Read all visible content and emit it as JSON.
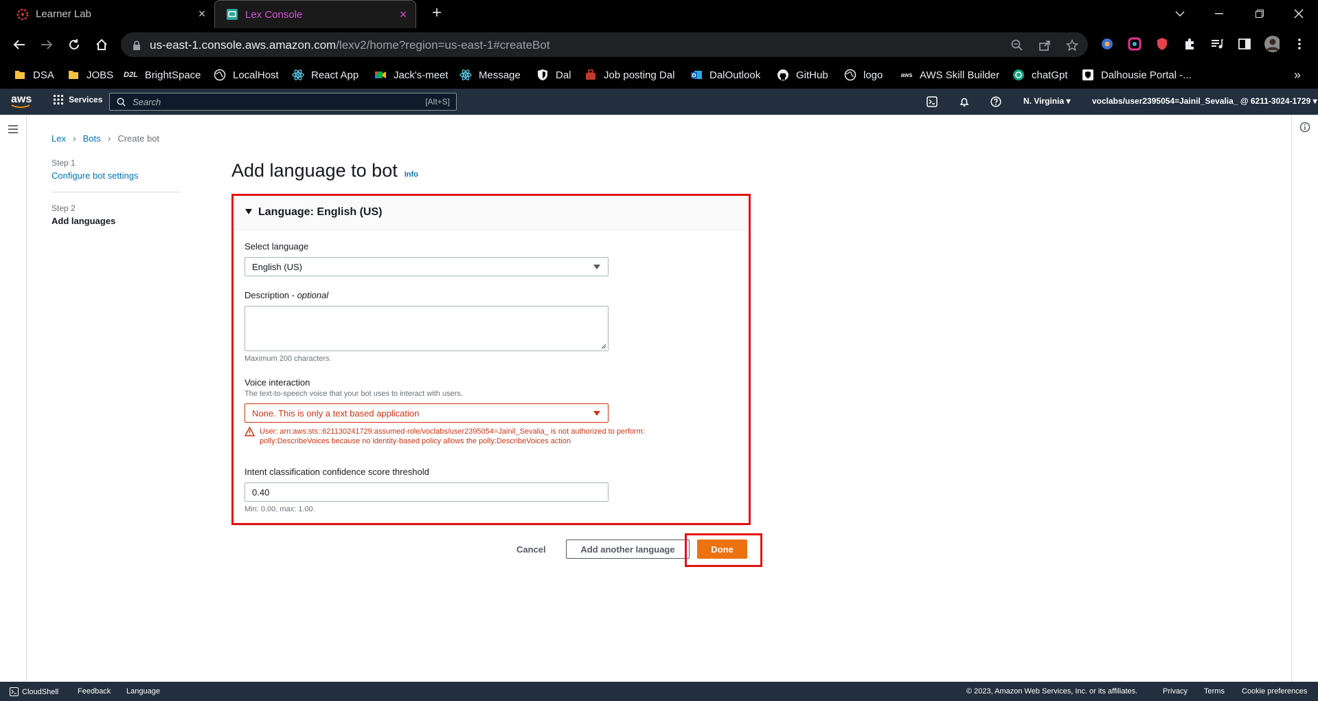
{
  "browser": {
    "tabs": [
      {
        "title": "Learner Lab",
        "active": false
      },
      {
        "title": "Lex Console",
        "active": true
      }
    ],
    "url_host": "us-east-1.console.aws.amazon.com",
    "url_path": "/lexv2/home?region=us-east-1#createBot",
    "bookmarks": [
      "DSA",
      "JOBS",
      "BrightSpace",
      "LocalHost",
      "React App",
      "Jack's-meet",
      "Message",
      "Dal",
      "Job posting Dal",
      "DalOutlook",
      "GitHub",
      "logo",
      "AWS Skill Builder",
      "chatGpt",
      "Dalhousie Portal -..."
    ],
    "bookmarks_prefix": "D2L"
  },
  "aws_header": {
    "logo": "aws",
    "services_label": "Services",
    "search_placeholder": "Search",
    "search_shortcut": "[Alt+S]",
    "region": "N. Virginia",
    "account": "voclabs/user2395054=Jainil_Sevalia_ @ 6211-3024-1729"
  },
  "breadcrumb": [
    "Lex",
    "Bots",
    "Create bot"
  ],
  "steps": [
    {
      "label": "Step 1",
      "title": "Configure bot settings",
      "current": false
    },
    {
      "label": "Step 2",
      "title": "Add languages",
      "current": true
    }
  ],
  "page_title": "Add language to bot",
  "info_link": "Info",
  "panel": {
    "header": "Language: English (US)",
    "select_language_label": "Select language",
    "select_language_value": "English (US)",
    "description_label": "Description - ",
    "description_optional": "optional",
    "description_hint": "Maximum 200 characters.",
    "voice_label": "Voice interaction",
    "voice_desc": "The text-to-speech voice that your bot uses to interact with users.",
    "voice_value": "None. This is only a text based application",
    "voice_error": "User: arn:aws:sts::621130241729:assumed-role/voclabs/user2395054=Jainil_Sevalia_ is not authorized to perform: polly:DescribeVoices because no identity-based policy allows the polly:DescribeVoices action",
    "threshold_label": "Intent classification confidence score threshold",
    "threshold_value": "0.40",
    "threshold_hint": "Min: 0.00, max: 1.00."
  },
  "actions": {
    "cancel": "Cancel",
    "add_another": "Add another language",
    "done": "Done"
  },
  "footer": {
    "cloudshell": "CloudShell",
    "feedback": "Feedback",
    "language": "Language",
    "copyright": "© 2023, Amazon Web Services, Inc. or its affiliates.",
    "privacy": "Privacy",
    "terms": "Terms",
    "cookies": "Cookie preferences"
  },
  "colors": {
    "aws_nav": "#232f3e",
    "link": "#0073bb",
    "error": "#d13212",
    "primary_button": "#ec7211",
    "highlight": "#e41111"
  }
}
